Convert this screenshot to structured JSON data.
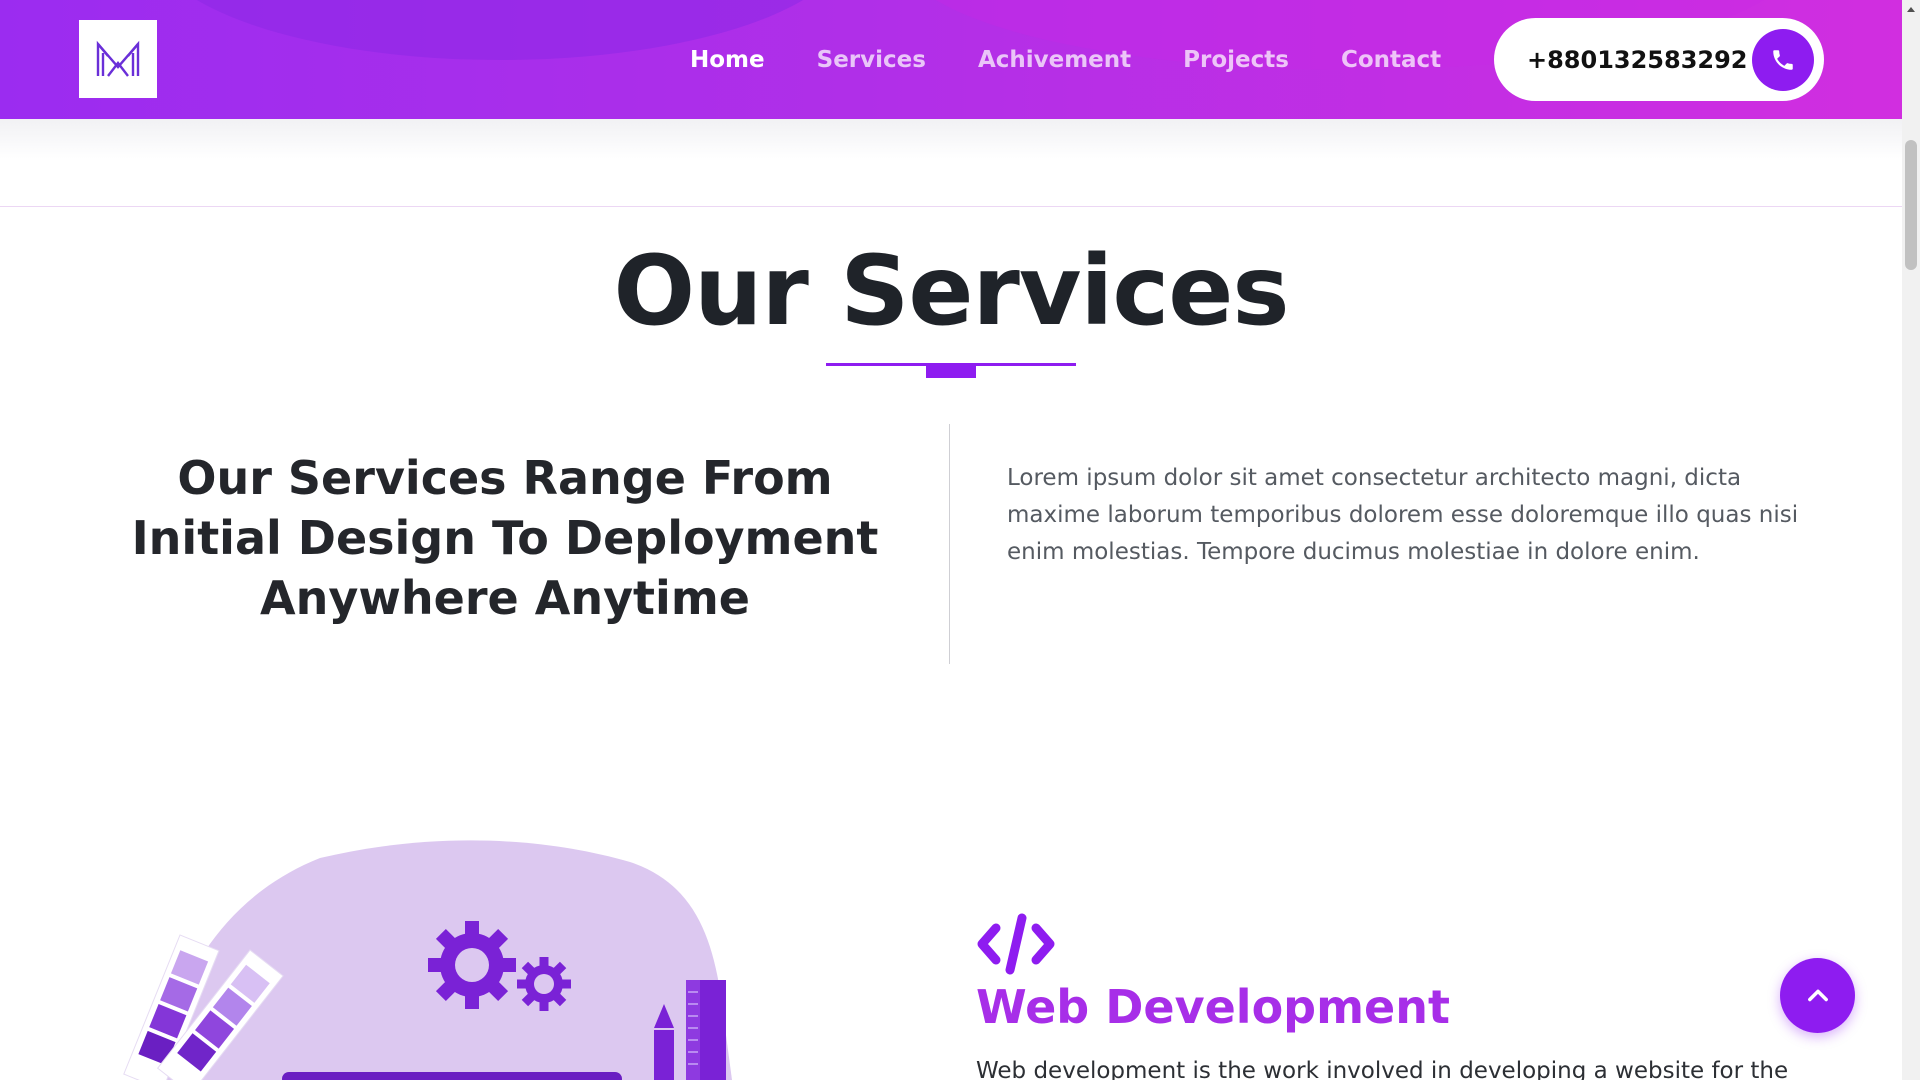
{
  "header": {
    "logo_icon": "logo-m-icon",
    "nav": [
      {
        "label": "Home",
        "active": true
      },
      {
        "label": "Services",
        "active": false
      },
      {
        "label": "Achivement",
        "active": false
      },
      {
        "label": "Projects",
        "active": false
      },
      {
        "label": "Contact",
        "active": false
      }
    ],
    "phone": "+880132583292",
    "phone_icon": "phone-icon"
  },
  "services": {
    "title": "Our Services",
    "heading": "Our Services Range From Initial Design To Deployment Anywhere Anytime",
    "intro": "Lorem ipsum dolor sit amet consectetur architecto magni, dicta maxime laborum temporibus dolorem esse doloremque illo quas nisi enim molestias. Tempore ducimus molestiae in dolore enim.",
    "items": [
      {
        "icon": "code-icon",
        "title": "Web Development",
        "description": "Web development is the work involved in developing a website for the"
      }
    ]
  },
  "scroll_top_icon": "chevron-up-icon",
  "colors": {
    "accent": "#8e1cf0",
    "accent_light": "#a72ee8",
    "header_start": "#9b2cf0",
    "header_end": "#d12ee0",
    "illustration_blob": "#dcc8f0"
  }
}
